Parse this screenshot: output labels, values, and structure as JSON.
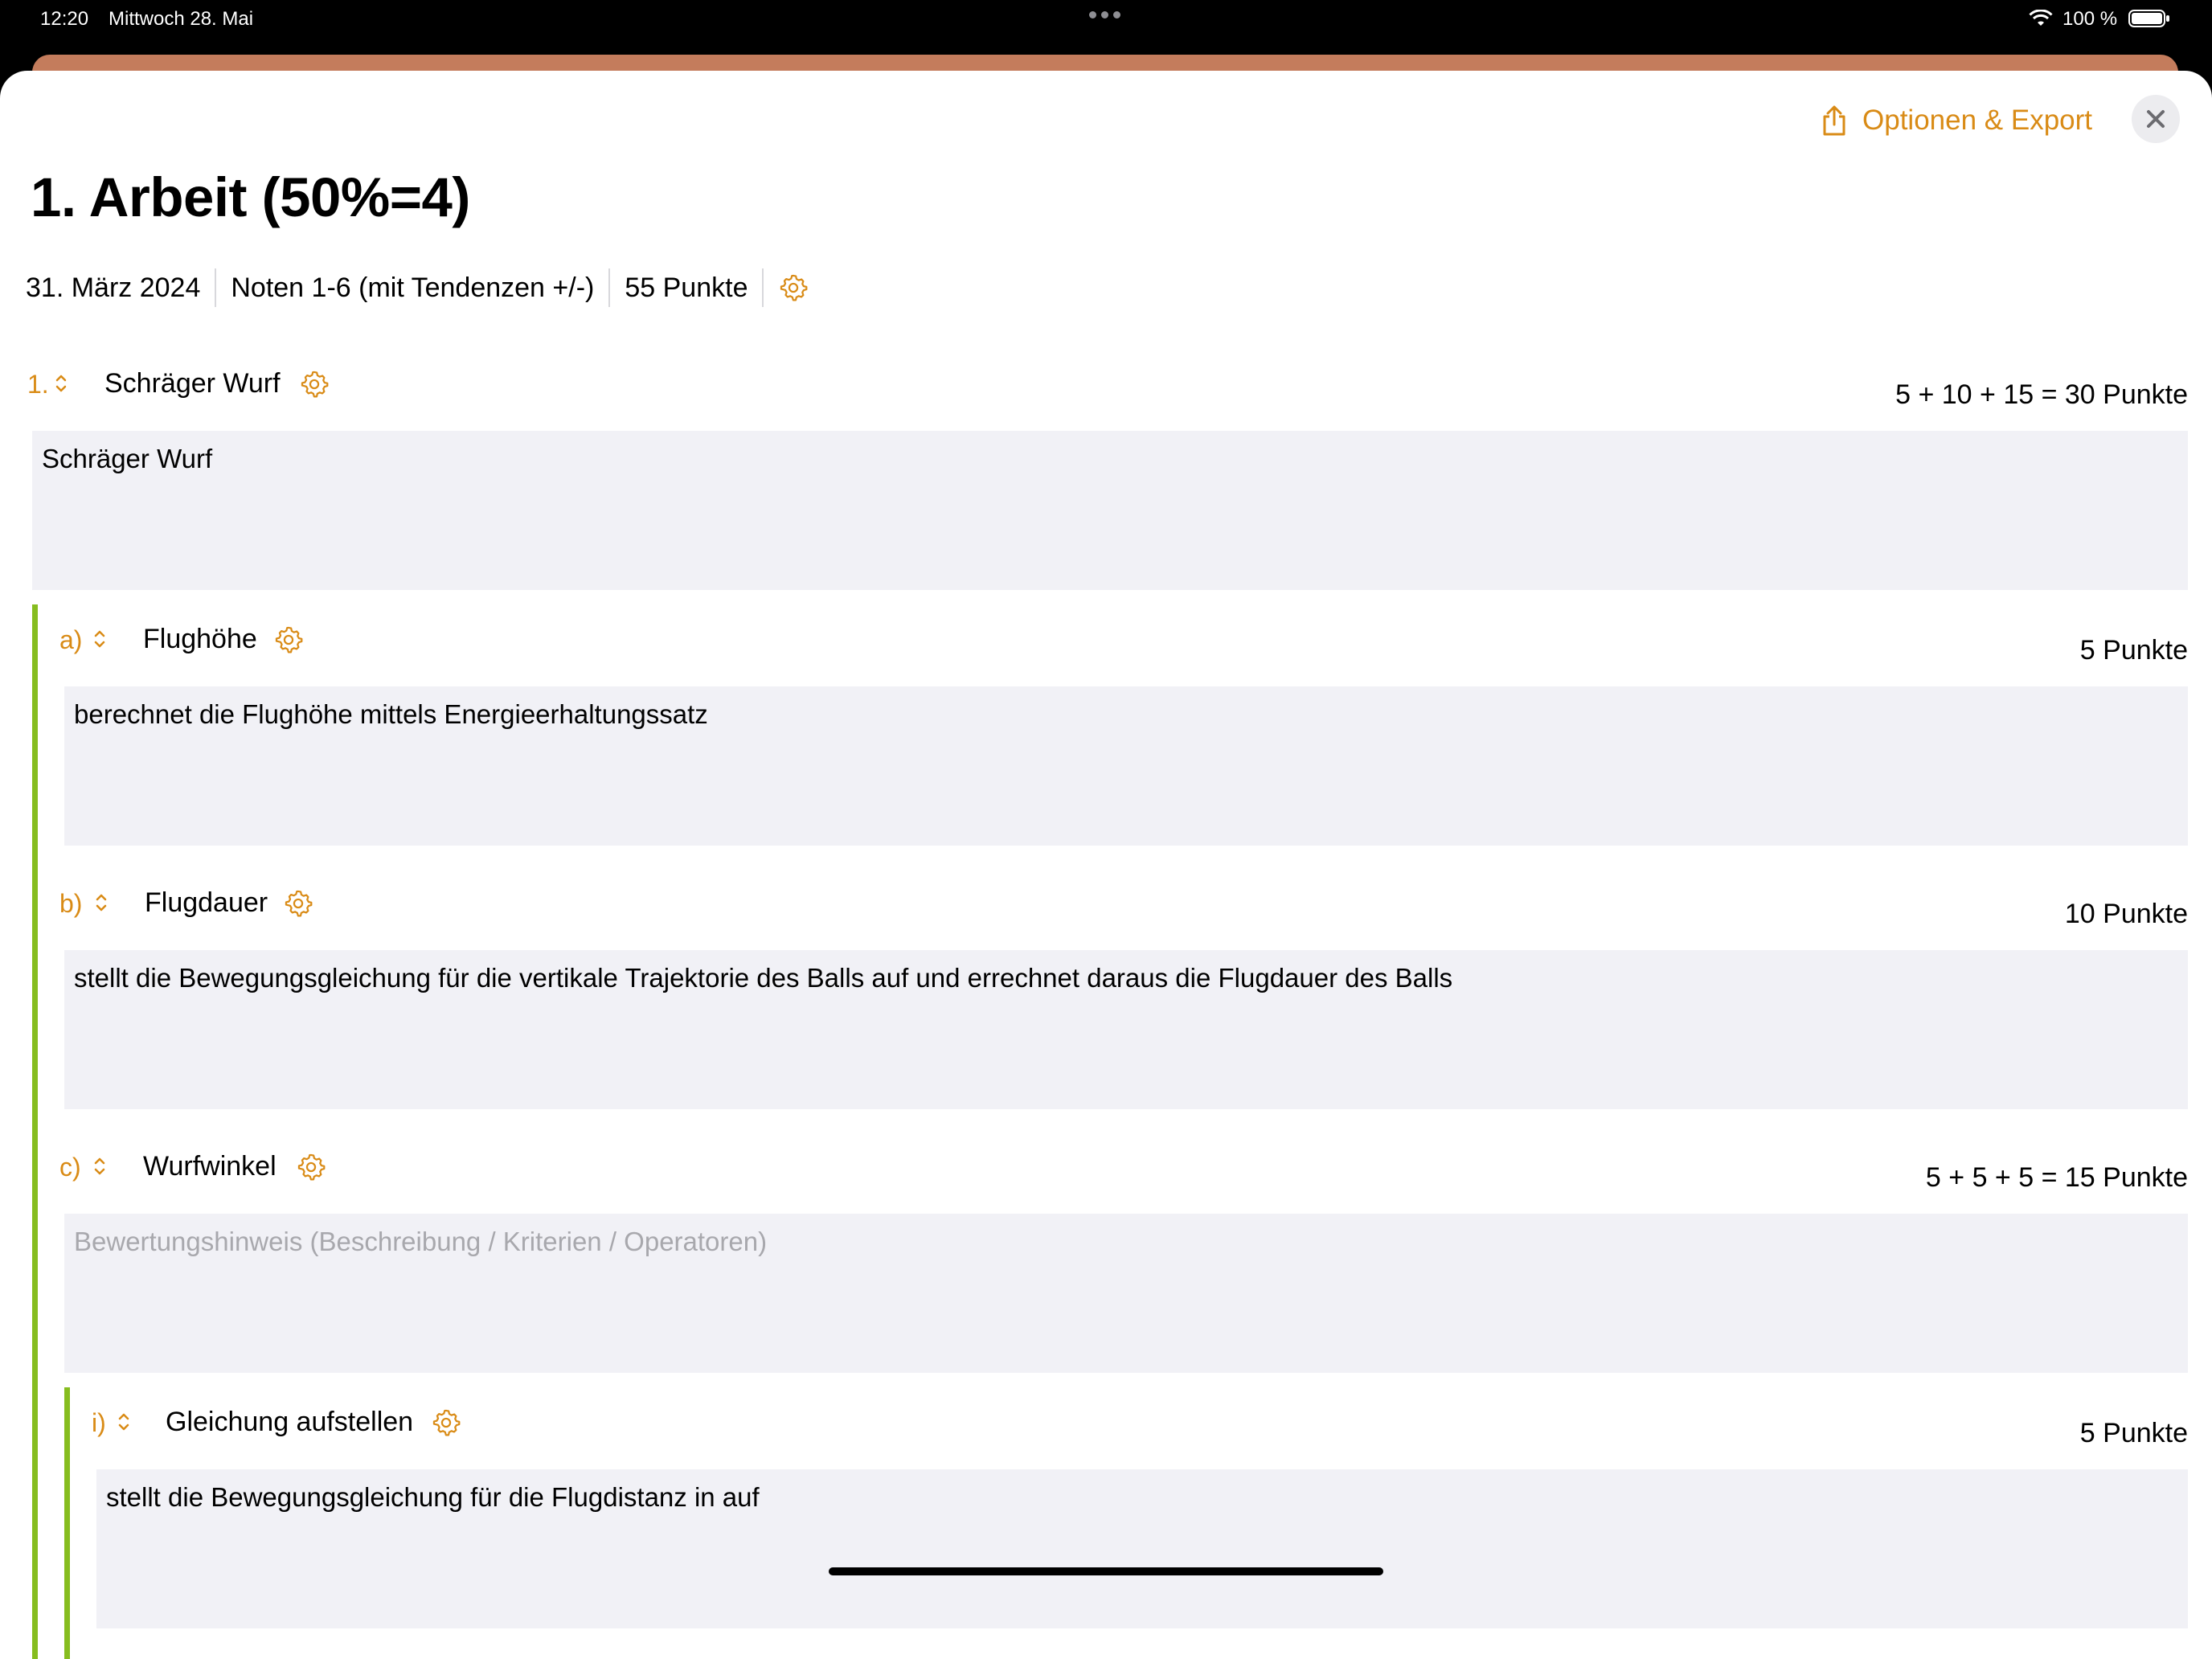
{
  "status": {
    "time": "12:20",
    "date": "Mittwoch 28. Mai",
    "battery": "100 %"
  },
  "header": {
    "export_label": "Optionen & Export"
  },
  "title": "1. Arbeit (50%=4)",
  "meta": {
    "date": "31. März 2024",
    "grading": "Noten 1-6 (mit Tendenzen +/-)",
    "points": "55 Punkte"
  },
  "tasks": [
    {
      "number": "1.",
      "title": "Schräger Wurf",
      "points": "5 + 10 + 15 = 30 Punkte",
      "description": "Schräger Wurf",
      "placeholder": ""
    },
    {
      "number": "a)",
      "title": "Flughöhe",
      "points": "5 Punkte",
      "description": "berechnet die Flughöhe mittels Energieerhaltungssatz",
      "placeholder": ""
    },
    {
      "number": "b)",
      "title": "Flugdauer",
      "points": "10 Punkte",
      "description": "stellt die Bewegungsgleichung für die vertikale Trajektorie des Balls auf und errechnet daraus die Flugdauer des Balls",
      "placeholder": ""
    },
    {
      "number": "c)",
      "title": "Wurfwinkel",
      "points": "5 + 5 + 5 = 15 Punkte",
      "description": "",
      "placeholder": "Bewertungshinweis (Beschreibung / Kriterien / Operatoren)"
    },
    {
      "number": "i)",
      "title": "Gleichung aufstellen",
      "points": "5 Punkte",
      "description": "stellt die Bewegungsgleichung für die Flugdistanz in auf",
      "placeholder": ""
    }
  ],
  "colors": {
    "accent": "#d98b16",
    "level_bar": "#86bd1f",
    "field_bg": "#f1f1f6",
    "top_sheet": "#c47c5c"
  },
  "icons": [
    "share-icon",
    "close-icon",
    "gear-icon",
    "chevron-updown-icon",
    "wifi-icon",
    "battery-icon"
  ]
}
